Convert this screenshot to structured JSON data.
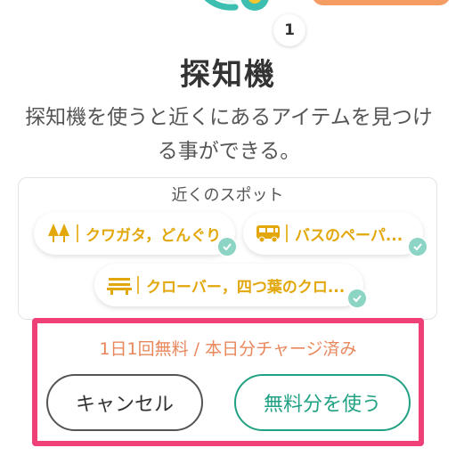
{
  "count_badge": "1",
  "title": "探知機",
  "description": "探知機を使うと近くにあるアイテムを見つける事ができる。",
  "spots": {
    "header": "近くのスポット",
    "items": [
      {
        "icon": "tree-icon",
        "label": "クワガタ，どんぐり",
        "checked": true
      },
      {
        "icon": "bus-icon",
        "label": "バスのペーパ...",
        "checked": true
      },
      {
        "icon": "bench-icon",
        "label": "クローバー，四つ葉のクロ...",
        "checked": true
      }
    ]
  },
  "charge_status": "1日1回無料 / 本日分チャージ済み",
  "buttons": {
    "cancel": "キャンセル",
    "use_free": "無料分を使う"
  },
  "colors": {
    "accent_green": "#21a183",
    "chip_gold": "#e2a70a",
    "highlight_pink": "#ef4077",
    "status_orange": "#e9875c"
  }
}
